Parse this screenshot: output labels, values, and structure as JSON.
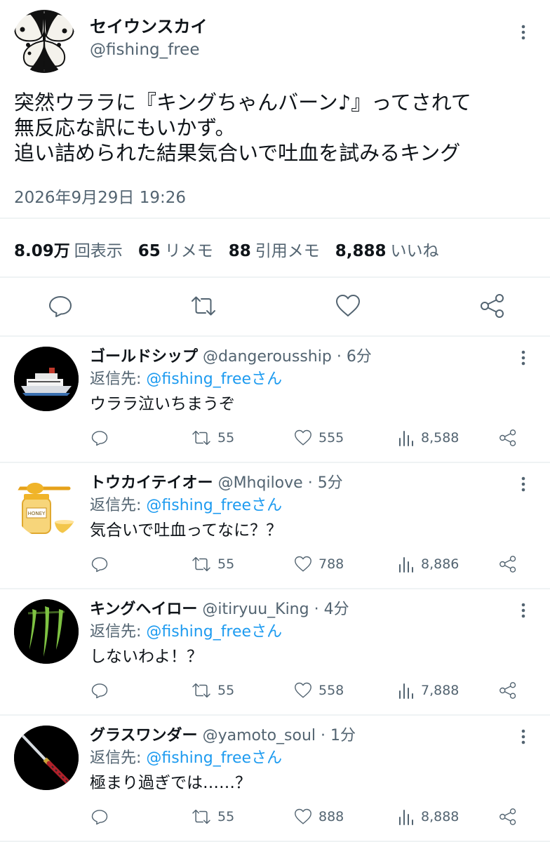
{
  "tweet": {
    "author_name": "セイウンスカイ",
    "author_handle": "@fishing_free",
    "text": "突然ウララに『キングちゃんバーン♪』ってされて\n無反応な訳にもいかず。\n追い詰められた結果気合いで吐血を試みるキング",
    "timestamp": "2026年9月29日 19:26",
    "stats": [
      {
        "value": "8.09万",
        "label": "回表示"
      },
      {
        "value": "65",
        "label": "リメモ"
      },
      {
        "value": "88",
        "label": "引用メモ"
      },
      {
        "value": "8,888",
        "label": "いいね"
      }
    ],
    "icons": [
      "more-icon",
      "reply-icon",
      "retweet-icon",
      "like-icon",
      "share-icon"
    ]
  },
  "replies": [
    {
      "name": "ゴールドシップ",
      "handle": "@dangerousship",
      "time": "6分",
      "reply_to_label": "返信先: ",
      "reply_to": "@fishing_freeさん",
      "text": "ウララ泣いちまうぞ",
      "retweets": "55",
      "likes": "555",
      "views": "8,588",
      "avatar": "ship"
    },
    {
      "name": "トウカイテイオー",
      "handle": "@Mhqilove",
      "time": "5分",
      "reply_to_label": "返信先: ",
      "reply_to": "@fishing_freeさん",
      "text": "気合いで吐血ってなに？？",
      "retweets": "55",
      "likes": "788",
      "views": "8,886",
      "avatar": "honey",
      "avatar_label": "HONEY"
    },
    {
      "name": "キングヘイロー",
      "handle": "@itiryuu_King",
      "time": "4分",
      "reply_to_label": "返信先: ",
      "reply_to": "@fishing_freeさん",
      "text": "しないわよ！？",
      "retweets": "55",
      "likes": "558",
      "views": "7,888",
      "avatar": "claw"
    },
    {
      "name": "グラスワンダー",
      "handle": "@yamoto_soul",
      "time": "1分",
      "reply_to_label": "返信先: ",
      "reply_to": "@fishing_freeさん",
      "text": "極まり過ぎでは……？",
      "retweets": "55",
      "likes": "888",
      "views": "8,888",
      "avatar": "sword"
    }
  ],
  "separator": " · ",
  "colors": {
    "text": "#0f1419",
    "secondary": "#536471",
    "link": "#1d9bf0",
    "divider": "#eff3f4",
    "claw_green": "#7ec242"
  }
}
